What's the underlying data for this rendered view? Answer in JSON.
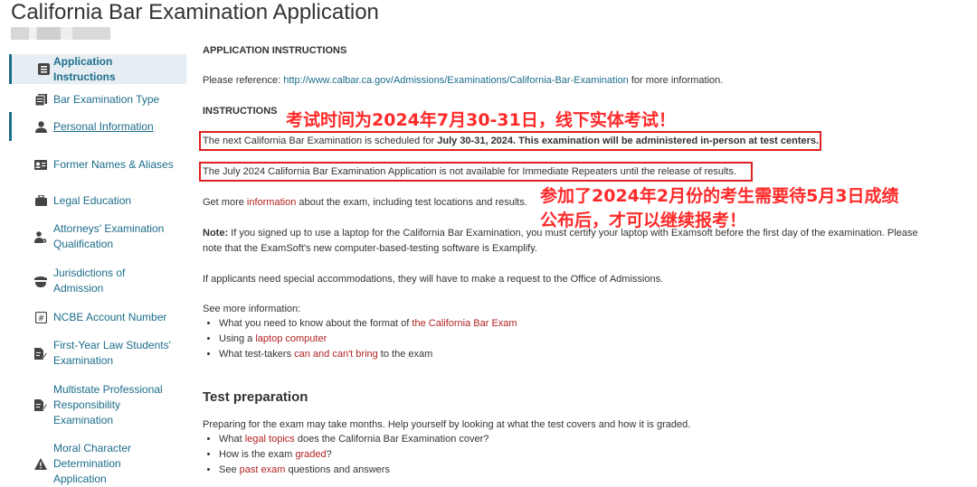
{
  "header": {
    "title": "California Bar Examination Application"
  },
  "sidebar": {
    "items": [
      {
        "label": "Application Instructions",
        "icon": "list-icon",
        "active": true
      },
      {
        "label": "Bar Examination Type",
        "icon": "documents-icon"
      },
      {
        "label": "Personal Information",
        "icon": "person-icon",
        "active_outline": true
      },
      {
        "label": "Former Names & Aliases",
        "icon": "id-card-icon"
      },
      {
        "label": "Legal Education",
        "icon": "briefcase-icon"
      },
      {
        "label": "Attorneys' Examination Qualification",
        "icon": "person-gear-icon"
      },
      {
        "label": "Jurisdictions of Admission",
        "icon": "courthouse-icon"
      },
      {
        "label": "NCBE Account Number",
        "icon": "hash-icon"
      },
      {
        "label": "First-Year Law Students' Examination",
        "icon": "document-pen-icon"
      },
      {
        "label": "Multistate Professional Responsibility Examination",
        "icon": "document-pen-icon"
      },
      {
        "label": "Moral Character Determination Application",
        "icon": "warning-icon"
      }
    ]
  },
  "main": {
    "section_heading": "APPLICATION INSTRUCTIONS",
    "reference_prefix": "Please reference: ",
    "reference_link": "http://www.calbar.ca.gov/Admissions/Examinations/California-Bar-Examination",
    "reference_suffix": " for more information.",
    "instructions_heading": "INSTRUCTIONS",
    "next_exam_prefix": "The next California Bar Examination is scheduled for ",
    "next_exam_bold": "July 30-31, 2024. This examination will be administered in-person at test centers.",
    "repeaters_text": "The July 2024 California Bar Examination Application is not available for Immediate Repeaters until the release of results.",
    "get_more_prefix": "Get more ",
    "get_more_link": "information",
    "get_more_suffix": " about the exam, including test locations and results.",
    "note_label": "Note:",
    "note_text_1": " If you signed up to use a laptop for the California Bar Examination, you must certify your laptop with Examsoft before the first day of the examination. Please",
    "note_text_2": "note that the ExamSoft's new computer-based-testing software is Examplify.",
    "accommodations": "If applicants need special accommodations, they will have to make a request to the Office of Admissions.",
    "see_more": "See more information:",
    "see_more_items": [
      {
        "prefix": "What you need to know about the format of ",
        "link": "the California Bar Exam",
        "suffix": ""
      },
      {
        "prefix": "Using a ",
        "link": "laptop computer",
        "suffix": ""
      },
      {
        "prefix": "What test-takers ",
        "link": "can and can't bring",
        "suffix": " to the exam"
      }
    ],
    "test_prep_heading": "Test preparation",
    "test_prep_text": "Preparing for the exam may take months. Help yourself by looking at what the test covers and how it is graded.",
    "test_prep_items": [
      {
        "prefix": "What ",
        "link": "legal topics",
        "suffix": " does the California Bar Examination cover?"
      },
      {
        "prefix": "How is the exam ",
        "link": "graded",
        "suffix": "?"
      },
      {
        "prefix": "See ",
        "link": "past exam",
        "suffix": " questions and answers"
      }
    ]
  },
  "annotations": {
    "exam_date_note": "考试时间为2024年7月30-31日，线下实体考试！",
    "repeaters_note_line1": "参加了2024年2月份的考生需要待5月3日成绩",
    "repeaters_note_line2": "公布后，才可以继续报考！"
  },
  "colors": {
    "link": "#1c6d8a",
    "red_link": "#b22222",
    "annotation": "#ff2a2a",
    "box": "#e02020",
    "active_bg": "#e6eef3"
  }
}
